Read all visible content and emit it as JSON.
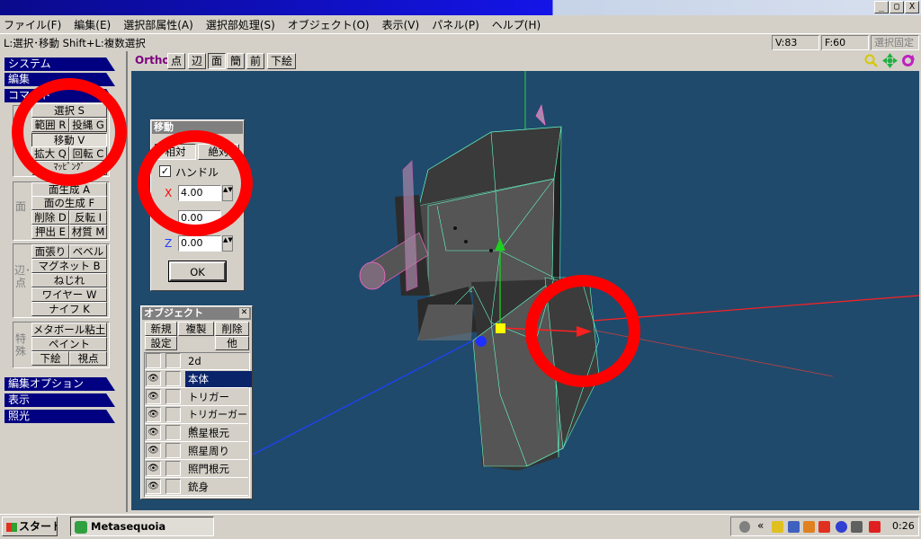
{
  "window": {
    "buttons": [
      "_",
      "▢",
      "X"
    ]
  },
  "menu": [
    "ファイル(F)",
    "編集(E)",
    "選択部属性(A)",
    "選択部処理(S)",
    "オブジェクト(O)",
    "表示(V)",
    "パネル(P)",
    "ヘルプ(H)"
  ],
  "status": {
    "hint": "L:選択･移動  Shift+L:複数選択",
    "vertices": "V:83",
    "faces": "F:60",
    "lock": "選択固定"
  },
  "left_panel": {
    "system": "システム",
    "edit": "編集",
    "command": "コマンド",
    "select": "選択 S",
    "range": "範囲 R",
    "lasso": "投縄 G",
    "move": "移動 V",
    "scale": "拡大 Q",
    "rotate": "回転 C",
    "mapping": "ﾏｯﾋﾟﾝｸﾞ",
    "hidden_row": "面生成 A",
    "face_label": "面",
    "face_create": "面の生成 F",
    "delete": "削除 D",
    "flip": "反転 I",
    "extrude": "押出 E",
    "material": "材質 M",
    "edge_label": "辺･点",
    "stretch": "面張り",
    "bevel": "ベベル",
    "magnet": "マグネット B",
    "twist": "ねじれ",
    "wire": "ワイヤー W",
    "knife": "ナイフ K",
    "special_label": "特殊",
    "metaball": "メタボール粘土",
    "paint": "ペイント",
    "underlay": "下絵",
    "viewpoint": "視点",
    "edit_option": "編集オプション",
    "display": "表示",
    "lighting": "照光"
  },
  "view_toolbar": {
    "ortho": "Ortho",
    "point": "点",
    "edge": "辺",
    "face": "面",
    "simple": "簡",
    "front": "前",
    "underlay": "下絵"
  },
  "move_panel": {
    "title": "移動",
    "tab_rel": "相対",
    "tab_abs": "絶対",
    "handle_label": "ハンドル",
    "handle_checked": true,
    "x_label": "X",
    "x_value": "4.00",
    "y_value": "0.00",
    "z_label": "Z",
    "z_value": "0.00",
    "ok": "OK"
  },
  "object_panel": {
    "title": "オブジェクト",
    "new": "新規",
    "copy": "複製",
    "delete": "削除",
    "settings": "設定",
    "other": "他",
    "objects": [
      "2d",
      "本体",
      "トリガー",
      "トリガーガード",
      "照星根元",
      "照星周り",
      "照門根元",
      "銃身"
    ],
    "selected_index": 1
  },
  "taskbar": {
    "start": "スタート",
    "app": "Metasequoia",
    "time": "0:26"
  },
  "colors": {
    "viewport_bg": "#1f4a6c",
    "section_header": "#000080",
    "selection_highlight": "#0a246a",
    "annotation_ring": "#ff0000",
    "wireframe": "#66ffcc"
  }
}
